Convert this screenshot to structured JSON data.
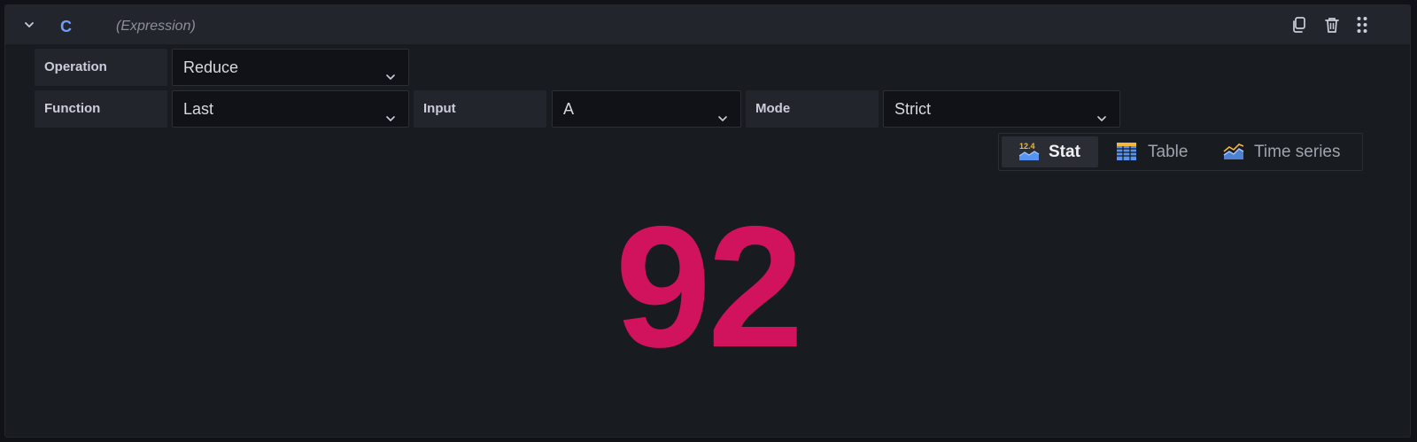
{
  "query": {
    "ref_id": "C",
    "datasource_label": "(Expression)"
  },
  "header_icons": [
    "chevron-down-icon",
    "duplicate-icon",
    "trash-icon",
    "drag-handle-icon"
  ],
  "operation": {
    "label": "Operation",
    "value": "Reduce"
  },
  "function": {
    "label": "Function",
    "value": "Last"
  },
  "input": {
    "label": "Input",
    "value": "A"
  },
  "mode": {
    "label": "Mode",
    "value": "Strict"
  },
  "viz_options": [
    {
      "label": "Stat",
      "icon": "stat-icon",
      "icon_text": "12.4",
      "active": true
    },
    {
      "label": "Table",
      "icon": "table-icon",
      "active": false
    },
    {
      "label": "Time series",
      "icon": "time-series-icon",
      "active": false
    }
  ],
  "stat": {
    "value": "92",
    "color": "#d1125c"
  },
  "colors": {
    "ref_id": "#6e9fff",
    "stat_icon_yellow": "#f5b73b",
    "stat_icon_blue": "#5794f2"
  }
}
